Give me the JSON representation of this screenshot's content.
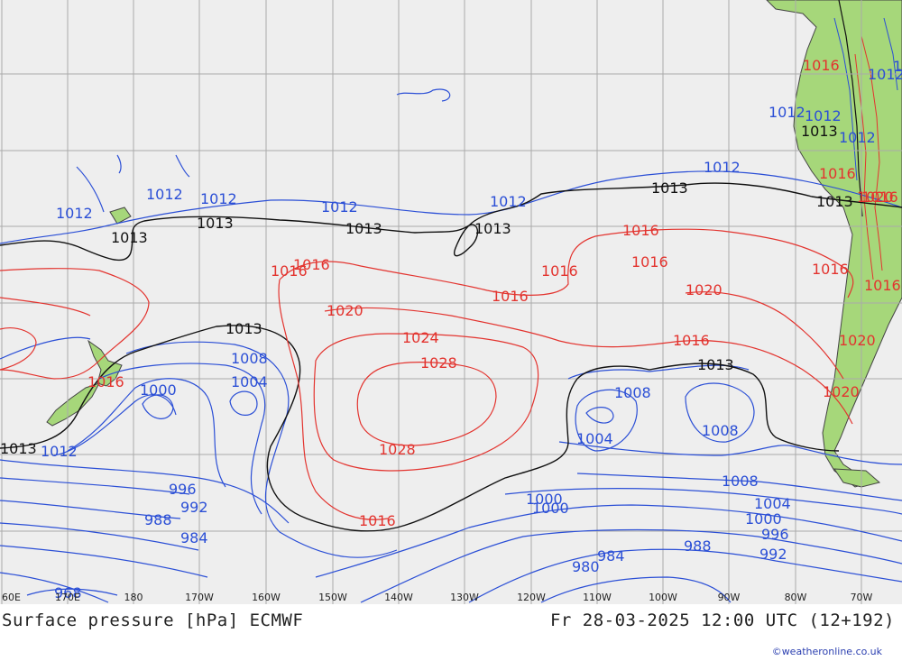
{
  "title": {
    "left": "Surface pressure [hPa] ECMWF",
    "right": "Fr 28-03-2025 12:00 UTC (12+192)"
  },
  "credit": "©weatheronline.co.uk",
  "colors": {
    "ocean": "#eeeeee",
    "land": "#a6d77a",
    "grid": "#aaaaaa",
    "isobar_high": "#e3342f",
    "isobar_low": "#2b4fd6",
    "isobar_1013": "#111111"
  },
  "longitude_ticks": [
    "60E",
    "170E",
    "180",
    "170W",
    "160W",
    "150W",
    "140W",
    "130W",
    "120W",
    "110W",
    "100W",
    "90W",
    "80W",
    "70W"
  ],
  "isobar_labels": {
    "red": [
      "1016",
      "1016",
      "1016",
      "1016",
      "1016",
      "1016",
      "1016",
      "1016",
      "1016",
      "1016",
      "1020",
      "1020",
      "1020",
      "1020",
      "1020",
      "1024",
      "1028",
      "1028",
      "1016",
      "1016",
      "1016",
      "1016"
    ],
    "black": [
      "1013",
      "1013",
      "1013",
      "1013",
      "1013",
      "1013",
      "1013",
      "1013",
      "1013",
      "1013"
    ],
    "blue": [
      "1012",
      "1012",
      "1012",
      "1012",
      "1012",
      "1012",
      "1012",
      "1012",
      "1012",
      "1012",
      "1012",
      "1008",
      "1008",
      "1008",
      "1008",
      "1004",
      "1004",
      "1004",
      "1000",
      "1000",
      "1000",
      "1000",
      "996",
      "996",
      "992",
      "992",
      "988",
      "988",
      "984",
      "984",
      "980",
      "968",
      "1012"
    ]
  }
}
